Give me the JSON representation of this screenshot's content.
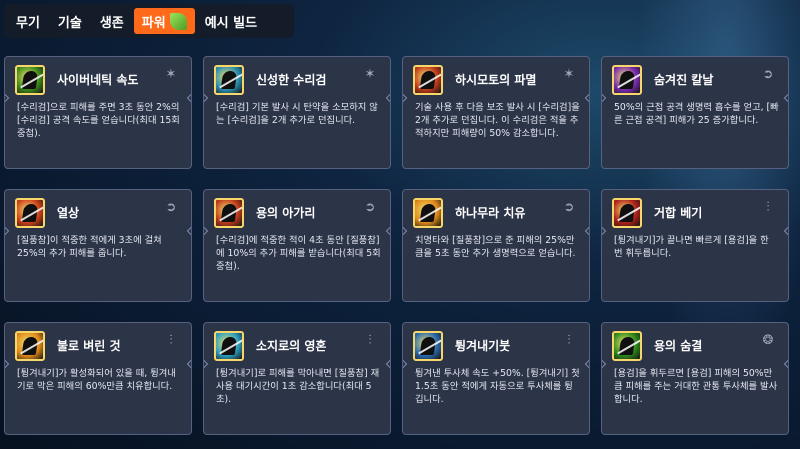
{
  "tabs": [
    {
      "label": "무기",
      "active": false
    },
    {
      "label": "기술",
      "active": false
    },
    {
      "label": "생존",
      "active": false
    },
    {
      "label": "파워",
      "active": true
    },
    {
      "label": "예시 빌드",
      "active": false
    }
  ],
  "colors": {
    "accent": "#ff6a1a",
    "card_bg": "#2c3448",
    "card_border": "#566080",
    "icon_frame": "#f7d66a"
  },
  "cards": [
    {
      "title": "사이버네틱 속도",
      "icon": "cybernetic-speed-icon",
      "corner_icon": "shuriken-type-icon",
      "icon_bg": "#3c8a1a",
      "desc": "[수리검]으로 피해를 주면 3초 동안 2%의 [수리검] 공격 속도를 얻습니다(최대 15회 중첩)."
    },
    {
      "title": "신성한 수리검",
      "icon": "sacred-shuriken-icon",
      "corner_icon": "shuriken-type-icon",
      "icon_bg": "#2a8fb0",
      "desc": "[수리검] 기본 발사 시 탄약을 소모하지 않는 [수리검]을 2개 추가로 던집니다."
    },
    {
      "title": "하시모토의 파멸",
      "icon": "hashimoto-bane-icon",
      "corner_icon": "shuriken-type-icon",
      "icon_bg": "#c23a1a",
      "desc": "기술 사용 후 다음 보조 발사 시 [수리검]을 2개 추가로 던집니다. 이 수리검은 적을 추적하지만 피해량이 50% 감소합니다."
    },
    {
      "title": "숨겨진 칼날",
      "icon": "hidden-blade-icon",
      "corner_icon": "swift-strike-type-icon",
      "icon_bg": "#7a2ab0",
      "desc": "50%의 근접 공격 생명력 흡수를 얻고, [빠른 근접 공격] 피해가 25 증가합니다."
    },
    {
      "title": "열상",
      "icon": "laceration-icon",
      "corner_icon": "swift-strike-type-icon",
      "icon_bg": "#d0401a",
      "desc": "[질풍참]이 적중한 적에게 3초에 걸쳐 25%의 추가 피해를 줍니다."
    },
    {
      "title": "용의 아가리",
      "icon": "dragons-jaw-icon",
      "corner_icon": "swift-strike-type-icon",
      "icon_bg": "#c23a1a",
      "desc": "[수리검]에 적중한 적이 4초 동안 [질풍참]에 10%의 추가 피해를 받습니다(최대 5회 중첩)."
    },
    {
      "title": "하나무라 치유",
      "icon": "hanamura-healing-icon",
      "corner_icon": "swift-strike-type-icon",
      "icon_bg": "#e08a1a",
      "desc": "치명타와 [질풍참]으로 준 피해의 25%만큼을 5초 동안 추가 생명력으로 얻습니다."
    },
    {
      "title": "거합 베기",
      "icon": "iaido-strike-icon",
      "corner_icon": "deflect-type-icon",
      "icon_bg": "#b0201a",
      "desc": "[튕겨내기]가 끝나면 빠르게 [용검]을 한 번 휘두릅니다."
    },
    {
      "title": "불로 벼린 것",
      "icon": "forged-under-fire-icon",
      "corner_icon": "deflect-type-icon",
      "icon_bg": "#e08a1a",
      "desc": "[튕겨내기]가 활성화되어 있을 때, 튕겨내기로 막은 피해의 60%만큼 치유합니다."
    },
    {
      "title": "소지로의 영혼",
      "icon": "soujirous-spirit-icon",
      "corner_icon": "deflect-type-icon",
      "icon_bg": "#2a9ec0",
      "desc": "[튕겨내기]로 피해를 막아내면 [질풍참] 재사용 대기시간이 1초 감소합니다(최대 5초)."
    },
    {
      "title": "튕겨내기붓",
      "icon": "deflect-brush-icon",
      "corner_icon": "deflect-type-icon",
      "icon_bg": "#2a6ab0",
      "desc": "튕겨낸 투사체 속도 +50%. [튕겨내기] 첫 1.5초 동안 적에게 자동으로 투사체를 튕깁니다."
    },
    {
      "title": "용의 숨결",
      "icon": "dragons-breath-icon",
      "corner_icon": "dragonblade-type-icon",
      "icon_bg": "#2a8a1a",
      "desc": "[용검]을 휘두르면 [용검] 피해의 50%만큼 피해를 주는 거대한 관통 투사체를 발사합니다."
    }
  ]
}
